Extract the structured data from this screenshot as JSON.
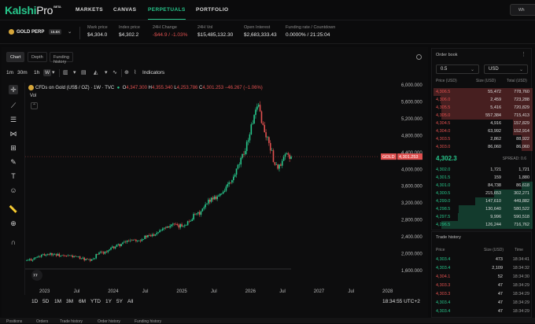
{
  "app": {
    "logo_main": "Kalshi",
    "logo_sub": "Pro",
    "logo_badge": "BETA",
    "top_button": "Wh"
  },
  "nav": [
    "MARKETS",
    "CANVAS",
    "PERPETUALS",
    "PORTFOLIO"
  ],
  "market": {
    "symbol": "GOLD PERP",
    "leverage": "15.8X",
    "stats": [
      {
        "label": "Mark price",
        "value": "$4,304.0",
        "negative": false
      },
      {
        "label": "Index price",
        "value": "$4,302.2",
        "negative": false
      },
      {
        "label": "24H Change",
        "value": "-$44.9 / -1.03%",
        "negative": true
      },
      {
        "label": "24H Vol",
        "value": "$15,485,132.30",
        "negative": false
      },
      {
        "label": "Open Interest",
        "value": "$2,683,333.43",
        "negative": false
      },
      {
        "label": "Funding rate / Countdown",
        "value": "0.0000% / 21:25:04",
        "negative": false
      }
    ]
  },
  "chart_tabs": [
    "Chart",
    "Depth",
    "Funding history"
  ],
  "toolbar": {
    "tf": [
      "1m",
      "30m",
      "1h",
      "W"
    ],
    "indicators": "Indicators"
  },
  "legend": {
    "title": "CFDs on Gold (US$ / OZ) · 1W · TVC",
    "o_label": "O",
    "o": "4,347.300",
    "h_label": "H",
    "h": "4,355.340",
    "l_label": "L",
    "l": "4,253.786",
    "c_label": "C",
    "c": "4,301.253",
    "chg": "−46.267 (−1.06%)",
    "vol": "Vol"
  },
  "chart_data": {
    "type": "candlestick",
    "title": "CFDs on Gold (US$ / OZ) · 1W · TVC",
    "x_ticks": [
      "2023",
      "Jul",
      "2024",
      "Jul",
      "2025",
      "Jul",
      "2026",
      "Jul",
      "2027",
      "Jul",
      "2028"
    ],
    "y_ticks": [
      "6,000.000",
      "5,600.000",
      "5,200.000",
      "4,800.000",
      "4,400.000",
      "4,000.000",
      "3,600.000",
      "3,200.000",
      "2,800.000",
      "2,400.000",
      "2,000.000",
      "1,600.000"
    ],
    "y_range": [
      1600,
      6000
    ],
    "last_price_label": "4,301.253",
    "price_line_label": "GOLD",
    "series_approx_close": [
      1830,
      1870,
      1920,
      1960,
      2000,
      1990,
      1960,
      1930,
      1950,
      1920,
      1900,
      1850,
      1830,
      1980,
      2030,
      2050,
      2150,
      2200,
      2250,
      2330,
      2340,
      2330,
      2400,
      2420,
      2500,
      2600,
      2650,
      2700,
      2630,
      2680,
      2750,
      2900,
      2950,
      3100,
      3300,
      3350,
      3400,
      3600,
      3700,
      4000,
      4300,
      4700,
      5200,
      5500,
      4900,
      4600,
      4100,
      4050,
      4350,
      4300
    ]
  },
  "bottom": {
    "ranges": [
      "1D",
      "5D",
      "1M",
      "3M",
      "6M",
      "YTD",
      "1Y",
      "5Y",
      "All"
    ],
    "clock": "18:34:55 UTC+2"
  },
  "bottom_tabs": [
    "Positions",
    "Orders",
    "Trade history",
    "Order history",
    "Funding history"
  ],
  "orderbook": {
    "title": "Order book",
    "tick": "0.5",
    "currency": "USD",
    "headers": [
      "Price (USD)",
      "Size (USD)",
      "Total (USD)"
    ],
    "asks": [
      [
        "4,306.5",
        "55,472",
        "778,760"
      ],
      [
        "4,306.0",
        "2,459",
        "723,288"
      ],
      [
        "4,305.5",
        "5,416",
        "720,829"
      ],
      [
        "4,305.0",
        "557,384",
        "715,413"
      ],
      [
        "4,304.5",
        "4,916",
        "157,829"
      ],
      [
        "4,304.0",
        "63,992",
        "152,914"
      ],
      [
        "4,303.5",
        "2,862",
        "88,922"
      ],
      [
        "4,303.0",
        "86,060",
        "86,060"
      ]
    ],
    "mid": "4,302.3",
    "spread": "SPREAD: 0.6",
    "bids": [
      [
        "4,302.0",
        "1,721",
        "1,721"
      ],
      [
        "4,301.5",
        "159",
        "1,880"
      ],
      [
        "4,301.0",
        "84,738",
        "86,618"
      ],
      [
        "4,300.5",
        "215,653",
        "302,271"
      ],
      [
        "4,299.0",
        "147,610",
        "449,882"
      ],
      [
        "4,298.5",
        "130,640",
        "580,522"
      ],
      [
        "4,297.5",
        "9,996",
        "590,518"
      ],
      [
        "4,296.5",
        "126,244",
        "716,762"
      ]
    ]
  },
  "trade_history": {
    "title": "Trade history",
    "headers": [
      "Price",
      "Size (USD)",
      "Time"
    ],
    "rows": [
      [
        "4,303.4",
        "473",
        "18:34:41",
        "g"
      ],
      [
        "4,303.4",
        "2,109",
        "18:34:32",
        "g"
      ],
      [
        "4,304.1",
        "52",
        "18:34:30",
        "r"
      ],
      [
        "4,303.3",
        "47",
        "18:34:29",
        "r"
      ],
      [
        "4,303.3",
        "47",
        "18:34:29",
        "r"
      ],
      [
        "4,303.4",
        "47",
        "18:34:29",
        "g"
      ],
      [
        "4,303.4",
        "47",
        "18:34:29",
        "g"
      ]
    ]
  }
}
